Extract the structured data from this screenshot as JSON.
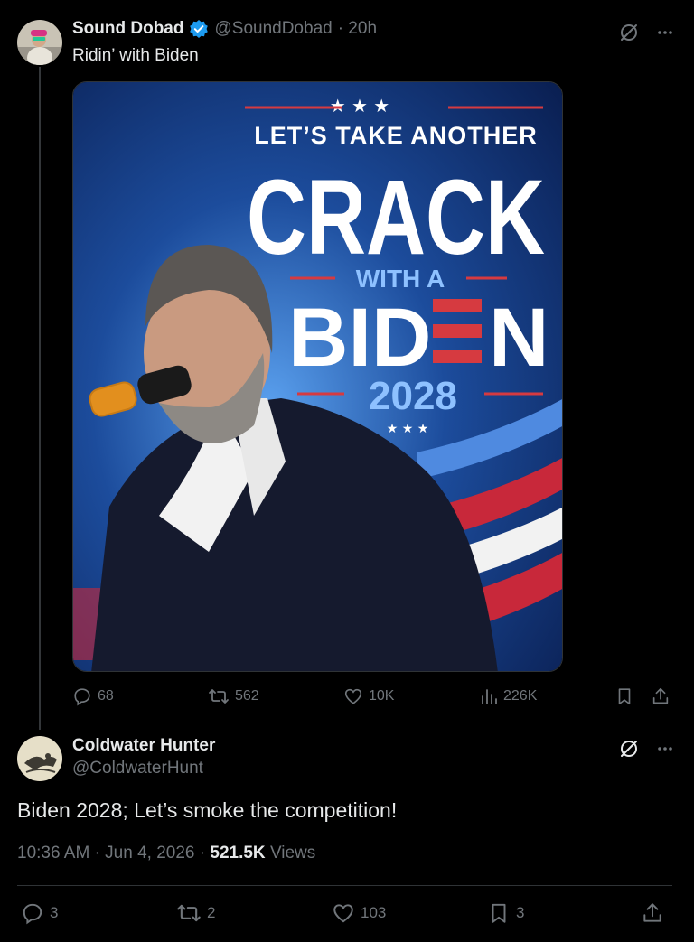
{
  "tweet1": {
    "display_name": "Sound Dobad",
    "handle": "@SoundDobad",
    "time": "· 20h",
    "text": "Ridin’ with Biden",
    "image": {
      "line1": "LET’S TAKE ANOTHER",
      "line2": "CRACK",
      "line3": "WITH A",
      "line4a": "BID",
      "line4b": "N",
      "line5": "2028"
    },
    "stats": {
      "replies": "68",
      "reposts": "562",
      "likes": "10K",
      "views": "226K"
    }
  },
  "tweet2": {
    "display_name": "Coldwater Hunter",
    "handle": "@ColdwaterHunt",
    "text": "Biden 2028; Let’s smoke the competition!",
    "time": "10:36 AM",
    "date": "Jun 4, 2026",
    "views_count": "521.5K",
    "views_label": "Views",
    "stats": {
      "replies": "3",
      "reposts": "2",
      "likes": "103",
      "bookmarks": "3"
    }
  },
  "colors": {
    "background": "#000000",
    "text": "#e7e9ea",
    "muted": "#71767b",
    "verified": "#1d9bf0",
    "divider": "#2f3336"
  }
}
